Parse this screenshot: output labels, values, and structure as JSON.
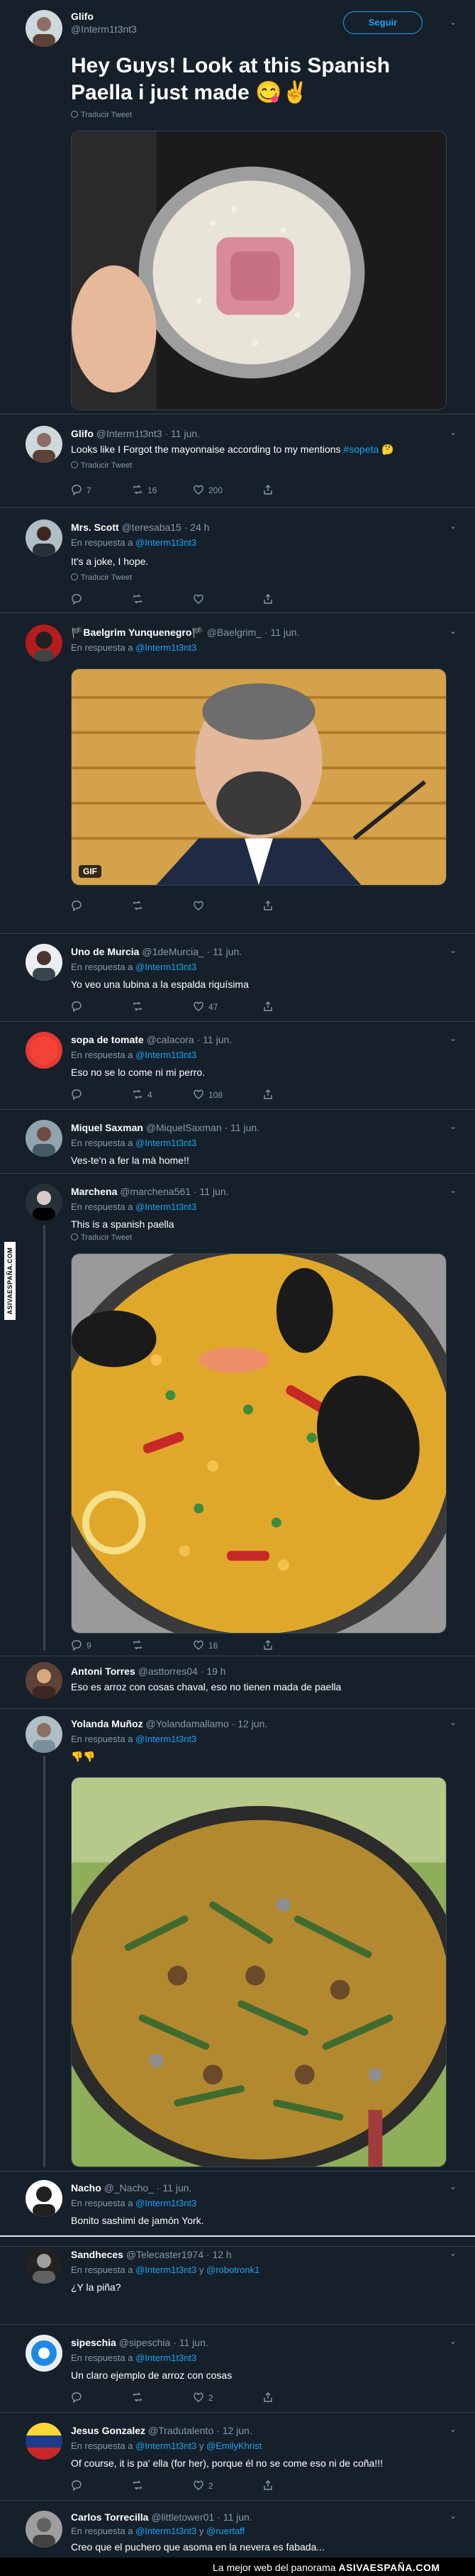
{
  "colors": {
    "bg": "#15202b",
    "accent": "#1da1f2",
    "muted": "#8899a6",
    "border": "#38444d"
  },
  "main_tweet": {
    "name": "Glifo",
    "handle": "@Interm1t3nt3",
    "follow_label": "Seguir",
    "text": "Hey Guys! Look at this Spanish Paella i just made 😋✌️",
    "translate": "Traducir Tweet"
  },
  "tweets": [
    {
      "id": "t1",
      "name": "Glifo",
      "handle": "@Interm1t3nt3",
      "time": "11 jun.",
      "reply_prefix": "",
      "reply_to": "",
      "text": "Looks like I Forgot the mayonnaise according to my mentions ",
      "hashtag": "#sopeta",
      "emoji": "🤔",
      "translate": "Traducir Tweet",
      "replies": "7",
      "retweets": "16",
      "likes": "200"
    },
    {
      "id": "t2",
      "name": "Mrs. Scott",
      "handle": "@teresaba15",
      "time": "24 h",
      "reply_prefix": "En respuesta a",
      "reply_to": "@Interm1t3nt3",
      "text": "It's a joke, I hope.",
      "translate": "Traducir Tweet",
      "replies": "",
      "retweets": "",
      "likes": ""
    },
    {
      "id": "t3",
      "name": "🏴Baelgrim Yunquenegro🏴",
      "handle": "@Baelgrim_",
      "time": "11 jun.",
      "reply_prefix": "En respuesta a",
      "reply_to": "@Interm1t3nt3",
      "gif_label": "GIF",
      "replies": "",
      "retweets": "",
      "likes": ""
    },
    {
      "id": "t4",
      "name": "Uno de Murcia",
      "handle": "@1deMurcia_",
      "time": "11 jun.",
      "reply_prefix": "En respuesta a",
      "reply_to": "@Interm1t3nt3",
      "text": "Yo veo una lubina a la espalda riquísima",
      "replies": "",
      "retweets": "",
      "likes": "47"
    },
    {
      "id": "t5",
      "name": "sopa de tomate",
      "handle": "@calacora",
      "time": "11 jun.",
      "reply_prefix": "En respuesta a",
      "reply_to": "@Interm1t3nt3",
      "text": "Eso no se lo come ni mi perro.",
      "replies": "",
      "retweets": "4",
      "likes": "108"
    },
    {
      "id": "t6",
      "name": "Miquel Saxman",
      "handle": "@MiquelSaxman",
      "time": "11 jun.",
      "reply_prefix": "En respuesta a",
      "reply_to": "@Interm1t3nt3",
      "text": "Ves-te'n a fer la mà home!!"
    },
    {
      "id": "t7",
      "name": "Marchena",
      "handle": "@marchena561",
      "time": "11 jun.",
      "reply_prefix": "En respuesta a",
      "reply_to": "@Interm1t3nt3",
      "text": "This is a spanish paella",
      "translate": "Traducir Tweet",
      "replies": "9",
      "retweets": "",
      "likes": "16"
    },
    {
      "id": "t8",
      "name": "Antoni Torres",
      "handle": "@asttorres04",
      "time": "19 h",
      "text": "Eso es arroz con cosas chaval, eso no tienen mada de paella"
    },
    {
      "id": "t9",
      "name": "Yolanda Muñoz",
      "handle": "@Yolandamallamo",
      "time": "12 jun.",
      "reply_prefix": "En respuesta a",
      "reply_to": "@Interm1t3nt3",
      "text": "👎👎"
    },
    {
      "id": "t10",
      "name": "Nacho",
      "handle": "@_Nacho_",
      "time": "11 jun.",
      "reply_prefix": "En respuesta a",
      "reply_to": "@Interm1t3nt3",
      "text": "Bonito sashimi de jamón York."
    },
    {
      "id": "t11",
      "name": "Sandheces",
      "handle": "@Telecaster1974",
      "time": "12 h",
      "reply_prefix": "En respuesta a",
      "reply_to": "@Interm1t3nt3",
      "reply_extra": "@robotronk1",
      "text": "¿Y la piña?"
    },
    {
      "id": "t12",
      "name": "sipeschia",
      "handle": "@sipeschia",
      "time": "11 jun.",
      "reply_prefix": "En respuesta a",
      "reply_to": "@Interm1t3nt3",
      "text": "Un claro ejemplo de arroz con cosas",
      "replies": "",
      "retweets": "",
      "likes": "2"
    },
    {
      "id": "t13",
      "name": "Jesus Gonzalez",
      "handle": "@Tradutalento",
      "time": "12 jun.",
      "reply_prefix": "En respuesta a",
      "reply_to": "@Interm1t3nt3",
      "reply_extra": "@EmilyKhrist",
      "text": "Of course, it is pa' ella (for her), porque él no se come eso ni de coña!!!",
      "replies": "",
      "retweets": "",
      "likes": "2"
    },
    {
      "id": "t14",
      "name": "Carlos Torrecilla",
      "handle": "@littletower01",
      "time": "11 jun.",
      "reply_prefix": "En respuesta a",
      "reply_to": "@Interm1t3nt3",
      "reply_extra": "@ruertaff",
      "text": "Creo que el puchero que asoma en la nevera es fabada..."
    }
  ],
  "and_label": "y",
  "side_tag": "ASIVAESPAÑA.COM",
  "footer": {
    "prefix": "La mejor web del panorama",
    "brand": "ASIVAESPAÑA.COM"
  }
}
